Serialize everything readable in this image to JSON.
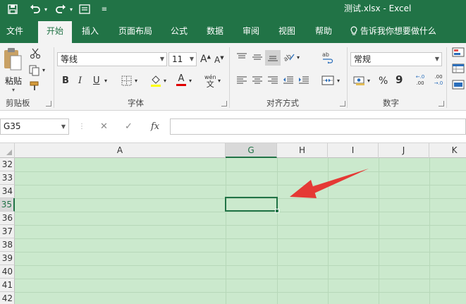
{
  "titlebar": {
    "doc_title": "测试.xlsx  -  Excel",
    "save_icon": "save-icon",
    "undo_icon": "undo-icon",
    "redo_icon": "redo-icon",
    "form_icon": "form-icon",
    "customize_icon": "customize-qat-icon"
  },
  "tabs": [
    "文件",
    "开始",
    "插入",
    "页面布局",
    "公式",
    "数据",
    "审阅",
    "视图",
    "帮助"
  ],
  "active_tab": "开始",
  "tellme": "告诉我你想要做什么",
  "ribbon": {
    "clipboard": {
      "paste_label": "粘贴",
      "group_label": "剪贴板"
    },
    "font": {
      "font_name": "等线",
      "font_size": "11",
      "group_label": "字体",
      "bold": "B",
      "italic": "I",
      "underline": "U",
      "grow": "A",
      "shrink": "A",
      "font_color_letter": "A",
      "wen": "wén"
    },
    "alignment": {
      "group_label": "对齐方式"
    },
    "number": {
      "format": "常规",
      "group_label": "数字",
      "percent": "%",
      "comma": "9",
      "inc_dec": "←.0 .00",
      "dec_dec": ".00 →.0"
    }
  },
  "formula_bar": {
    "name_box": "G35",
    "cancel": "✕",
    "enter": "✓",
    "fx": "fx",
    "value": ""
  },
  "grid": {
    "columns": [
      "A",
      "G",
      "H",
      "I",
      "J",
      "K"
    ],
    "selected_column": "G",
    "rows": [
      "32",
      "33",
      "34",
      "35",
      "36",
      "37",
      "38",
      "39",
      "40",
      "41",
      "42"
    ],
    "selected_row": "35",
    "active_cell": "G35"
  },
  "colors": {
    "excel_green": "#217346",
    "sheet_background": "#cbe9cd",
    "arrow": "#e53935"
  }
}
